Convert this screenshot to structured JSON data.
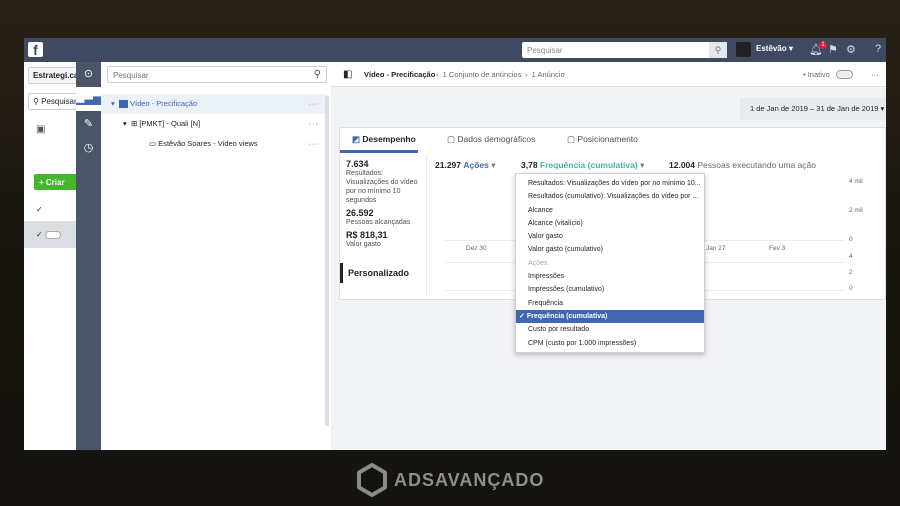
{
  "topbar": {
    "search_placeholder": "Pesquisar",
    "user": "Estêvão",
    "notif_count": "1"
  },
  "left": {
    "account": "Estrategi.ca",
    "search": "Pesquisar",
    "create": "+ Criar"
  },
  "tree": {
    "search_placeholder": "Pesquisar",
    "items": [
      {
        "label": "Vídeo - Precificação"
      },
      {
        "label": "[PMKT] - Quali [N]"
      },
      {
        "label": "Estêvão Soares - Video views"
      }
    ]
  },
  "header": {
    "breadcrumb": [
      "Vídeo - Precificação",
      "1 Conjunto de anúncios",
      "1 Anúncio"
    ],
    "status": "Inativo"
  },
  "date_range": "1 de Jan de 2019 – 31 de Jan de 2019",
  "tabs": [
    "Desempenho",
    "Dados demográficos",
    "Posicionamento"
  ],
  "summary": [
    {
      "value": "7.634",
      "label": "Resultados: Visualizações do vídeo por no mínimo 10 segundos"
    },
    {
      "value": "26.592",
      "label": "Pessoas alcançadas"
    },
    {
      "value": "R$ 818,31",
      "label": "Valor gasto"
    }
  ],
  "custom_label": "Personalizado",
  "metrics": {
    "m1_value": "21.297",
    "m1_label": "Ações",
    "m2_value": "3,78",
    "m2_label": "Frequência (cumulativa)",
    "m3_value": "12.004",
    "m3_label": "Pessoas executando uma ação"
  },
  "chart": {
    "y_top": [
      "4 mil",
      "2 mil",
      "0"
    ],
    "y_bottom": [
      "4",
      "2",
      "0"
    ],
    "x": [
      "Dez 30",
      "Jan 27",
      "Fev 3"
    ]
  },
  "dropdown": {
    "items": [
      "Resultados: Visualizações do vídeo por no mínimo 10...",
      "Resultados (cumulativo): Visualizações do vídeo por ...",
      "Alcance",
      "Alcance (vitalício)",
      "Valor gasto",
      "Valor gasto (cumulativo)",
      "Ações",
      "Impressões",
      "Impressões (cumulativo)",
      "Frequência",
      "Frequência (cumulativa)",
      "Custo por resultado",
      "CPM (custo por 1.000 impressões)"
    ],
    "selected": "Frequência (cumulativa)",
    "disabled": "Ações"
  },
  "brand": "ADSAVANÇADO",
  "colors": {
    "topbar": "#3d4a62",
    "accent": "#4267b2",
    "green": "#42b72a",
    "teal": "#3fb5a3"
  }
}
